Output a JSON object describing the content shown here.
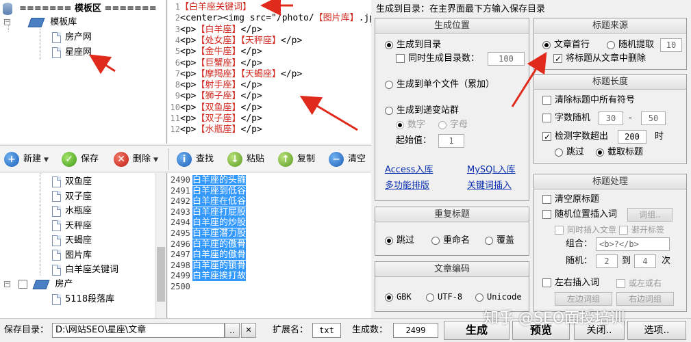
{
  "tree_top": {
    "root_label": "======= 模板区 =======",
    "library_label": "模板库",
    "items": [
      "房产网",
      "星座网"
    ]
  },
  "editor": {
    "lines": [
      {
        "num": "1",
        "segments": [
          {
            "t": "【白羊座关键词】",
            "red": true
          }
        ]
      },
      {
        "num": "2",
        "segments": [
          {
            "t": "<center><img src=\"/photo/",
            "red": false
          },
          {
            "t": "【图片库】",
            "red": true
          },
          {
            "t": ".jp",
            "red": false
          }
        ]
      },
      {
        "num": "3",
        "segments": [
          {
            "t": "<p>",
            "red": false
          },
          {
            "t": "【白羊座】",
            "red": true
          },
          {
            "t": "</p>",
            "red": false
          }
        ]
      },
      {
        "num": "4",
        "segments": [
          {
            "t": "<p>",
            "red": false
          },
          {
            "t": "【处女座】【天秤座】",
            "red": true
          },
          {
            "t": "</p>",
            "red": false
          }
        ]
      },
      {
        "num": "5",
        "segments": [
          {
            "t": "<p>",
            "red": false
          },
          {
            "t": "【金牛座】",
            "red": true
          },
          {
            "t": "</p>",
            "red": false
          }
        ]
      },
      {
        "num": "6",
        "segments": [
          {
            "t": "<p>",
            "red": false
          },
          {
            "t": "【巨蟹座】",
            "red": true
          },
          {
            "t": "</p>",
            "red": false
          }
        ]
      },
      {
        "num": "7",
        "segments": [
          {
            "t": "<p>",
            "red": false
          },
          {
            "t": "【摩羯座】【天蝎座】",
            "red": true
          },
          {
            "t": "</p>",
            "red": false
          }
        ]
      },
      {
        "num": "8",
        "segments": [
          {
            "t": "<p>",
            "red": false
          },
          {
            "t": "【射手座】",
            "red": true
          },
          {
            "t": "</p>",
            "red": false
          }
        ]
      },
      {
        "num": "9",
        "segments": [
          {
            "t": "<p>",
            "red": false
          },
          {
            "t": "【狮子座】",
            "red": true
          },
          {
            "t": "</p>",
            "red": false
          }
        ]
      },
      {
        "num": "10",
        "segments": [
          {
            "t": "<p>",
            "red": false
          },
          {
            "t": "【双鱼座】",
            "red": true
          },
          {
            "t": "</p>",
            "red": false
          }
        ]
      },
      {
        "num": "11",
        "segments": [
          {
            "t": "<p>",
            "red": false
          },
          {
            "t": "【双子座】",
            "red": true
          },
          {
            "t": "</p>",
            "red": false
          }
        ]
      },
      {
        "num": "12",
        "segments": [
          {
            "t": "<p>",
            "red": false
          },
          {
            "t": "【水瓶座】",
            "red": true
          },
          {
            "t": "</p>",
            "red": false
          }
        ]
      }
    ]
  },
  "toolbar": {
    "new": "新建",
    "save": "保存",
    "delete": "删除",
    "find": "查找",
    "paste": "粘贴",
    "copy": "复制",
    "clear": "清空"
  },
  "tree_bottom": {
    "items": [
      "双鱼座",
      "双子座",
      "水瓶座",
      "天秤座",
      "天蝎座",
      "图片库",
      "白羊座关键词"
    ],
    "group_label": "房产",
    "group_item": "5118段落库"
  },
  "list": {
    "rows": [
      {
        "num": "2490",
        "text": "白羊座的头箍"
      },
      {
        "num": "2491",
        "text": "白羊座到低谷"
      },
      {
        "num": "2492",
        "text": "白羊座在低谷"
      },
      {
        "num": "2493",
        "text": "白羊座打屁股"
      },
      {
        "num": "2494",
        "text": "白羊座的炒股"
      },
      {
        "num": "2495",
        "text": "白羊座潜力股"
      },
      {
        "num": "2496",
        "text": "白羊座的傲骨"
      },
      {
        "num": "2497",
        "text": "白羊座的傲骨"
      },
      {
        "num": "2498",
        "text": "白羊座的锁骨"
      },
      {
        "num": "2499",
        "text": "白羊座挨打故"
      },
      {
        "num": "2500",
        "text": ""
      }
    ]
  },
  "settings": {
    "hint": "生成到目录：在主界面最下方输入保存目录",
    "position": {
      "title": "生成位置",
      "to_dir": "生成到目录",
      "gen_dir_count": "同时生成目录数：",
      "dir_count_value": "100",
      "to_single_file": "生成到单个文件（累加）",
      "to_site_group": "生成到递变站群",
      "digit": "数字",
      "letter": "字母",
      "start_label": "起始值：",
      "start_value": "1",
      "links": [
        "Access入库",
        "MySQL入库",
        "多功能排版",
        "关键词插入"
      ]
    },
    "title_source": {
      "title": "标题来源",
      "first_line": "文章首行",
      "random_extract": "随机提取",
      "random_value": "10",
      "remove_from_article": "将标题从文章中删除"
    },
    "title_length": {
      "title": "标题长度",
      "clear_symbols": "清除标题中所有符号",
      "random_count": "字数随机",
      "min": "30",
      "dash": "-",
      "max": "50",
      "check_exceed": "检测字数超出",
      "exceed_value": "200",
      "unit": "时",
      "skip": "跳过",
      "truncate": "截取标题"
    },
    "title_process": {
      "title": "标题处理",
      "clear_original": "清空原标题",
      "random_insert": "随机位置插入词",
      "word_group_btn": "词组..",
      "insert_article": "同时插入文章",
      "avoid_tags": "避开标签",
      "combo_label": "组合：",
      "combo_value": "<b>?</b>",
      "random_label": "随机：",
      "random_min": "2",
      "to": "到",
      "random_max": "4",
      "times": "次",
      "lr_insert": "左右插入词",
      "left_or_right": "或左或右",
      "left_words": "左边词组",
      "right_words": "右边词组"
    },
    "repeat_title": {
      "title": "重复标题",
      "skip": "跳过",
      "rename": "重命名",
      "overwrite": "覆盖"
    },
    "encoding": {
      "title": "文章编码",
      "gbk": "GBK",
      "utf8": "UTF-8",
      "unicode": "Unicode"
    }
  },
  "bottom": {
    "save_dir_label": "保存目录：",
    "save_dir_value": "D:\\网站SEO\\星座\\文章",
    "browse": "..",
    "clear_x": "✕",
    "ext_label": "扩展名：",
    "ext_value": "txt",
    "count_label": "生成数：",
    "count_value": "2499",
    "generate": "生成",
    "preview": "预览",
    "close": "关闭..",
    "options": "选项.."
  },
  "watermark": "知乎 @SEO面授培训",
  "colors": {
    "selection": "#3399ff",
    "keyword_red": "#d0261c",
    "link_blue": "#0a2fb0",
    "arrow_red": "#e02a1c"
  }
}
